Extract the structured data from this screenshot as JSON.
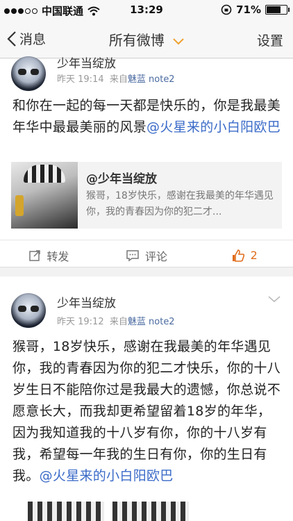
{
  "status": {
    "carrier": "中国联通",
    "time": "13:29",
    "battery": "71%"
  },
  "nav": {
    "back_label": "消息",
    "title": "所有微博",
    "settings_label": "设置"
  },
  "post1": {
    "username": "少年当绽放",
    "time": "昨天 19:14",
    "source_prefix": "来自",
    "source": "魅蓝 note2",
    "text": "和你在一起的每一天都是快乐的，你是我最美年华中最最美丽的风景",
    "mention": "@火星来的小白阳欧巴",
    "quote": {
      "name": "@少年当绽放",
      "text": "猴哥，18岁快乐，感谢在我最美的年华遇见你，我的青春因为你的犯二才..."
    },
    "actions": {
      "repost": "转发",
      "comment": "评论",
      "likes": "2"
    }
  },
  "post2": {
    "username": "少年当绽放",
    "time": "昨天 19:12",
    "source_prefix": "来自",
    "source": "魅蓝 note2",
    "text": "猴哥，18岁快乐，感谢在我最美的年华遇见你，我的青春因为你的犯二才快乐，你的十八岁生日不能陪你过是我最大的遗憾，你总说不愿意长大，而我却更希望留着18岁的年华，因为我知道我的十八岁有你，你的十八岁有我，希望每一年我的生日有你，你的生日有我。",
    "mention": "@火星来的小白阳欧巴"
  },
  "colors": {
    "mention": "#3a6ac8",
    "like": "#e06c1a",
    "nav_accent": "#f0a030"
  }
}
